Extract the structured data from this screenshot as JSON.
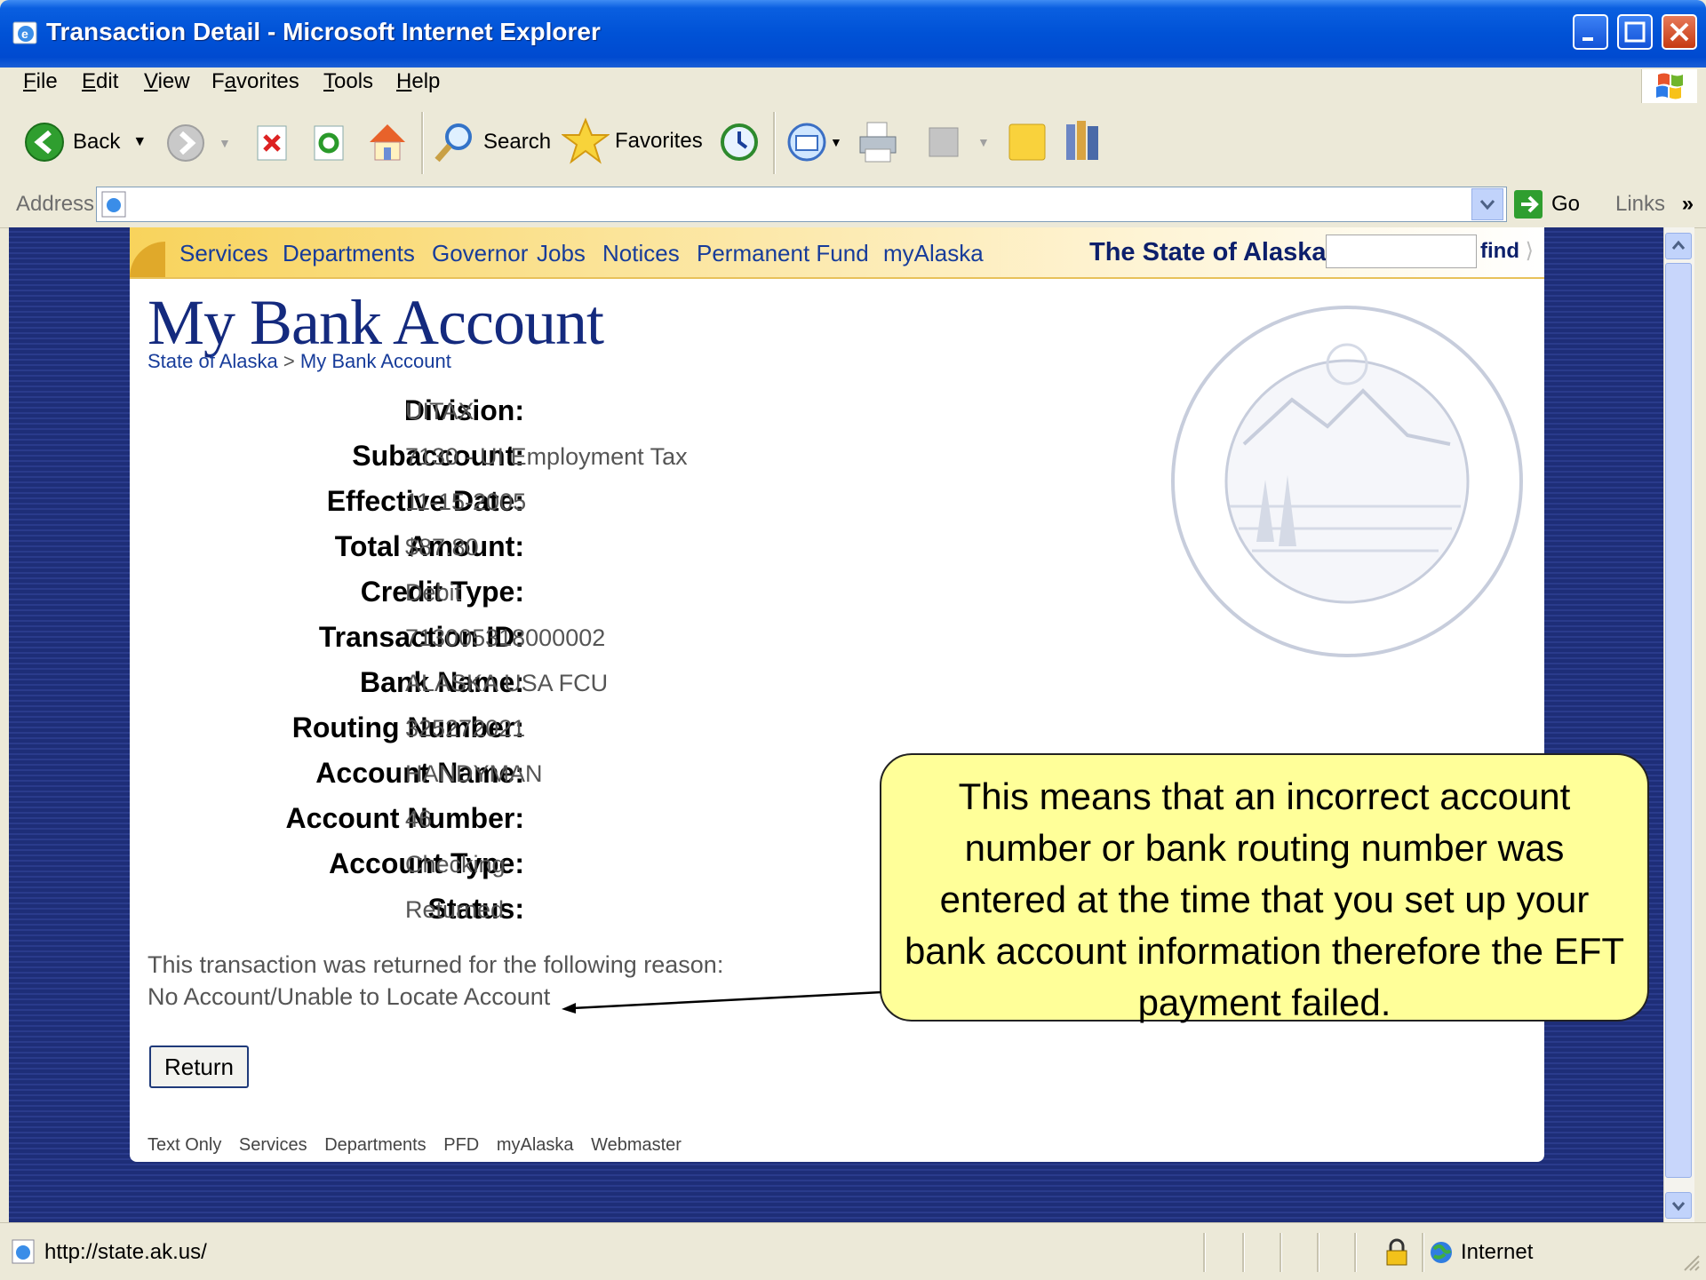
{
  "window": {
    "title": "Transaction Detail - Microsoft Internet Explorer"
  },
  "menu": [
    "File",
    "Edit",
    "View",
    "Favorites",
    "Tools",
    "Help"
  ],
  "menu_mnemonics": [
    "F",
    "E",
    "V",
    "a",
    "T",
    "H"
  ],
  "toolbar": {
    "back_label": "Back",
    "search_label": "Search",
    "favorites_label": "Favorites"
  },
  "addressbar": {
    "label": "Address",
    "value": "",
    "go_label": "Go",
    "links_label": "Links"
  },
  "site_nav": {
    "links": [
      "Services",
      "Departments",
      "Governor",
      "Jobs",
      "Notices",
      "Permanent Fund",
      "myAlaska"
    ],
    "state_name": "The State of Alaska",
    "find_label": "find"
  },
  "page": {
    "title": "My Bank Account",
    "breadcrumb": [
      "State of Alaska",
      "My Bank Account"
    ],
    "breadcrumb_sep": ">"
  },
  "transaction": [
    {
      "label": "Division:",
      "value": "UITAX"
    },
    {
      "label": "Subaccount:",
      "value": "7130 - UI Employment Tax"
    },
    {
      "label": "Effective Date:",
      "value": "11-15-2005"
    },
    {
      "label": "Total Amount:",
      "value": "$87.80"
    },
    {
      "label": "Credit Type:",
      "value": "Debit"
    },
    {
      "label": "Transaction ID:",
      "value": "713005318000002"
    },
    {
      "label": "Bank Name:",
      "value": "ALASKA USA FCU"
    },
    {
      "label": "Routing Number:",
      "value": "325272021"
    },
    {
      "label": "Account Name:",
      "value": "HANDYMAN"
    },
    {
      "label": "Account Number:",
      "value": "46"
    },
    {
      "label": "Account Type:",
      "value": "Checking"
    },
    {
      "label": "Status:",
      "value": "Returned"
    }
  ],
  "reason": {
    "intro": "This transaction was returned for the following reason:",
    "text": "No Account/Unable to Locate Account"
  },
  "return_button": "Return",
  "footer_links": [
    "Text Only",
    "Services",
    "Departments",
    "PFD",
    "myAlaska",
    "Webmaster"
  ],
  "callout": {
    "text": "This means that an incorrect account number or bank routing number was entered at the time that you set up your bank account information therefore the EFT payment failed."
  },
  "statusbar": {
    "url": "http://state.ak.us/",
    "zone": "Internet"
  },
  "colors": {
    "title_bar": "#0052d6",
    "site_blue": "#142a7e",
    "callout_bg": "#ffff99"
  }
}
